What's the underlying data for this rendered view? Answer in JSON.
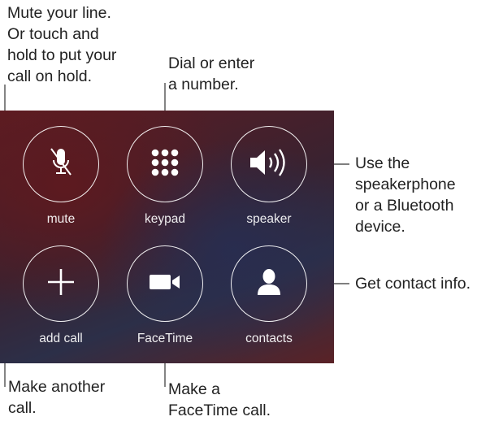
{
  "callouts": {
    "mute": "Mute your line.\nOr touch and\nhold to put your\ncall on hold.",
    "keypad": "Dial or enter\na number.",
    "speaker": "Use the\nspeakerphone\nor a Bluetooth\ndevice.",
    "contacts": "Get contact info.",
    "add_call": "Make another\ncall.",
    "facetime": "Make a\nFaceTime call."
  },
  "buttons": {
    "mute": {
      "label": "mute",
      "icon": "microphone-off-icon"
    },
    "keypad": {
      "label": "keypad",
      "icon": "keypad-grid-icon"
    },
    "speaker": {
      "label": "speaker",
      "icon": "speaker-icon"
    },
    "add_call": {
      "label": "add call",
      "icon": "plus-icon"
    },
    "facetime": {
      "label": "FaceTime",
      "icon": "video-camera-icon"
    },
    "contacts": {
      "label": "contacts",
      "icon": "person-icon"
    }
  },
  "colors": {
    "panel_red": "#5d1c22",
    "panel_blue": "#2c2f48",
    "text": "#222222"
  }
}
